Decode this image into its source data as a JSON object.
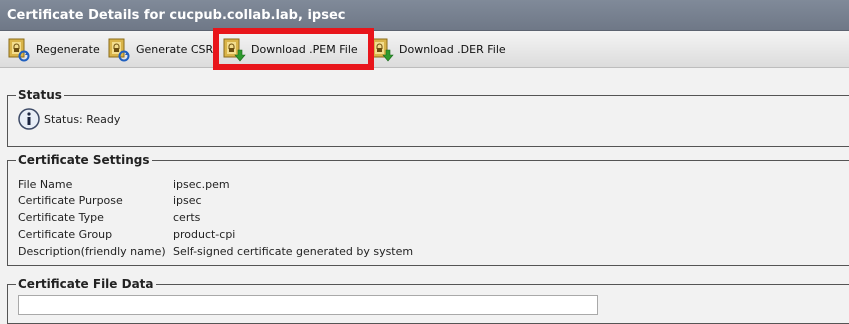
{
  "window": {
    "title": "Certificate Details for cucpub.collab.lab, ipsec"
  },
  "toolbar": {
    "regenerate_label": "Regenerate",
    "generate_csr_label": "Generate CSR",
    "download_pem_label": "Download .PEM File",
    "download_der_label": "Download .DER File",
    "highlight_color": "#e8151b"
  },
  "status": {
    "legend": "Status",
    "text": "Status: Ready",
    "icon": "info-icon"
  },
  "settings": {
    "legend": "Certificate Settings",
    "rows": [
      {
        "label": "File Name",
        "value": "ipsec.pem"
      },
      {
        "label": "Certificate Purpose",
        "value": "ipsec"
      },
      {
        "label": "Certificate Type",
        "value": "certs"
      },
      {
        "label": "Certificate Group",
        "value": "product-cpi"
      },
      {
        "label": "Description(friendly name)",
        "value": "Self-signed certificate generated by system"
      }
    ]
  },
  "file_data": {
    "legend": "Certificate File Data"
  },
  "colors": {
    "titlebar": "#7a8392",
    "background": "#f2f2f2"
  }
}
